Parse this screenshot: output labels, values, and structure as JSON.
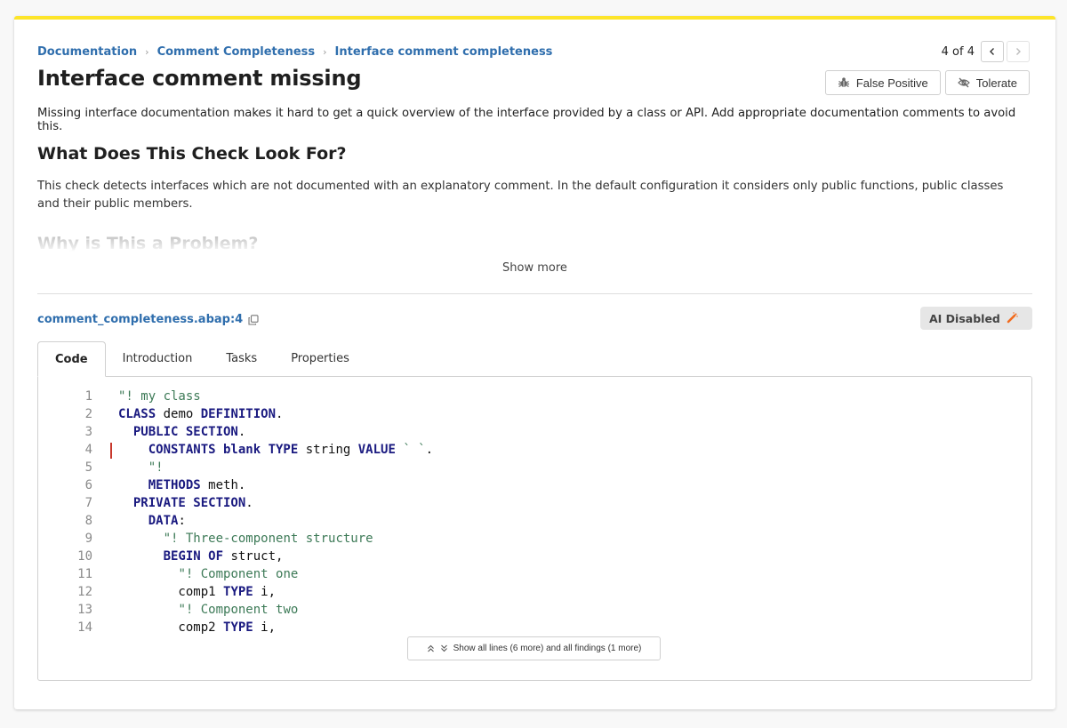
{
  "breadcrumb": [
    {
      "label": "Documentation"
    },
    {
      "label": "Comment Completeness"
    },
    {
      "label": "Interface comment completeness"
    }
  ],
  "breadcrumb_separator": "›",
  "pager": {
    "current": 4,
    "total": 4,
    "label": "4 of 4"
  },
  "title": "Interface comment missing",
  "actions": {
    "false_positive": "False Positive",
    "tolerate": "Tolerate"
  },
  "description": "Missing interface documentation makes it hard to get a quick overview of the interface provided by a class or API. Add appropriate documentation comments to avoid this.",
  "sections": [
    {
      "heading": "What Does This Check Look For?",
      "body": "This check detects interfaces which are not documented with an explanatory comment. In the default configuration it considers only public functions, public classes and their public members."
    },
    {
      "heading": "Why is This a Problem?"
    }
  ],
  "show_more": "Show more",
  "file": {
    "location": "comment_completeness.abap:4"
  },
  "ai_badge": {
    "label": "AI Disabled",
    "icon_color": "#f26b1d"
  },
  "tabs": [
    {
      "label": "Code",
      "active": true
    },
    {
      "label": "Introduction",
      "active": false
    },
    {
      "label": "Tasks",
      "active": false
    },
    {
      "label": "Properties",
      "active": false
    }
  ],
  "code": {
    "finding_line": 4,
    "lines": [
      {
        "n": "1",
        "tokens": [
          [
            "cm",
            "\"! my class"
          ]
        ]
      },
      {
        "n": "2",
        "tokens": [
          [
            "kw",
            "CLASS"
          ],
          [
            "pl",
            " demo "
          ],
          [
            "kw",
            "DEFINITION"
          ],
          [
            "pl",
            "."
          ]
        ]
      },
      {
        "n": "3",
        "tokens": [
          [
            "pl",
            "  "
          ],
          [
            "kw",
            "PUBLIC SECTION"
          ],
          [
            "pl",
            "."
          ]
        ]
      },
      {
        "n": "4",
        "tokens": [
          [
            "pl",
            "    "
          ],
          [
            "kw",
            "CONSTANTS blank TYPE"
          ],
          [
            "pl",
            " string "
          ],
          [
            "kw",
            "VALUE"
          ],
          [
            "cm",
            " ` `"
          ],
          [
            "pl",
            "."
          ]
        ]
      },
      {
        "n": "5",
        "tokens": [
          [
            "pl",
            "    "
          ],
          [
            "cm",
            "\"!"
          ]
        ]
      },
      {
        "n": "6",
        "tokens": [
          [
            "pl",
            "    "
          ],
          [
            "kw",
            "METHODS"
          ],
          [
            "pl",
            " meth."
          ]
        ]
      },
      {
        "n": "7",
        "tokens": [
          [
            "pl",
            "  "
          ],
          [
            "kw",
            "PRIVATE SECTION"
          ],
          [
            "pl",
            "."
          ]
        ]
      },
      {
        "n": "8",
        "tokens": [
          [
            "pl",
            "    "
          ],
          [
            "kw",
            "DATA"
          ],
          [
            "pl",
            ":"
          ]
        ]
      },
      {
        "n": "9",
        "tokens": [
          [
            "pl",
            "      "
          ],
          [
            "cm",
            "\"! Three-component structure"
          ]
        ]
      },
      {
        "n": "10",
        "tokens": [
          [
            "pl",
            "      "
          ],
          [
            "kw",
            "BEGIN OF"
          ],
          [
            "pl",
            " struct,"
          ]
        ]
      },
      {
        "n": "11",
        "tokens": [
          [
            "pl",
            "        "
          ],
          [
            "cm",
            "\"! Component one"
          ]
        ]
      },
      {
        "n": "12",
        "tokens": [
          [
            "pl",
            "        comp1 "
          ],
          [
            "kw",
            "TYPE"
          ],
          [
            "pl",
            " i,"
          ]
        ]
      },
      {
        "n": "13",
        "tokens": [
          [
            "pl",
            "        "
          ],
          [
            "cm",
            "\"! Component two"
          ]
        ]
      },
      {
        "n": "14",
        "tokens": [
          [
            "pl",
            "        comp2 "
          ],
          [
            "kw",
            "TYPE"
          ],
          [
            "pl",
            " i,"
          ]
        ]
      }
    ]
  },
  "show_all": "Show all lines (6 more) and all findings (1 more)",
  "colors": {
    "accent_bar": "#fde52a",
    "link": "#2f6ead",
    "keyword": "#1a1a80",
    "comment": "#3d7a57",
    "finding_marker": "#c8382c"
  }
}
